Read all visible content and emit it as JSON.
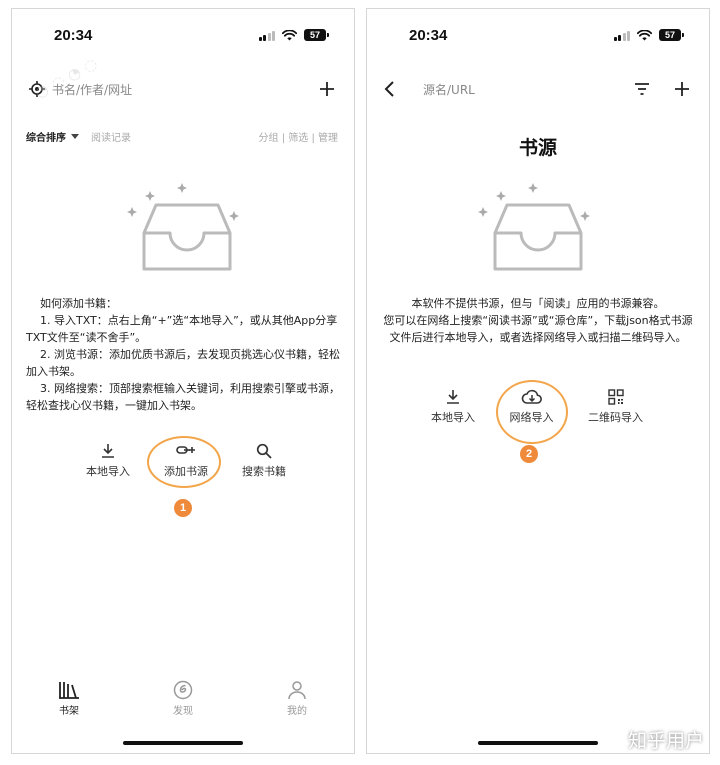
{
  "left": {
    "status_time": "20:34",
    "battery": "57",
    "search_placeholder": "书名/作者/网址",
    "sort_label": "综合排序",
    "history_label": "阅读记录",
    "filters": "分组 | 筛选 | 管理",
    "help": [
      "如何添加书籍：",
      "1. 导入TXT：点右上角“+”选“本地导入”，或从其他App分享TXT文件至“读不舍手”。",
      "2. 浏览书源：添加优质书源后，去发现页挑选心仪书籍，轻松加入书架。",
      "3. 网络搜索：顶部搜索框输入关键词，利用搜索引擎或书源，轻松查找心仪书籍，一键加入书架。"
    ],
    "actions": [
      {
        "label": "本地导入",
        "icon": "download-icon"
      },
      {
        "label": "添加书源",
        "icon": "link-plus-icon"
      },
      {
        "label": "搜索书籍",
        "icon": "search-icon"
      }
    ],
    "badge": "1",
    "nav": [
      {
        "label": "书架",
        "icon": "bookshelf-icon"
      },
      {
        "label": "发现",
        "icon": "discover-icon"
      },
      {
        "label": "我的",
        "icon": "person-icon"
      }
    ]
  },
  "right": {
    "status_time": "20:34",
    "battery": "57",
    "search_placeholder": "源名/URL",
    "title": "书源",
    "info": [
      "本软件不提供书源，但与「阅读」应用的书源兼容。",
      "您可以在网络上搜索“阅读书源”或“源仓库”，下载json格式书源文件后进行本地导入，或者选择网络导入或扫描二维码导入。"
    ],
    "actions": [
      {
        "label": "本地导入",
        "icon": "download-icon"
      },
      {
        "label": "网络导入",
        "icon": "cloud-download-icon"
      },
      {
        "label": "二维码导入",
        "icon": "qrcode-icon"
      }
    ],
    "badge": "2"
  },
  "overlay": {
    "corner_mark": "知乎用户"
  },
  "colors": {
    "highlight": "#f3a54a",
    "badge": "#ee8a3a",
    "muted": "#aaaaaa"
  }
}
